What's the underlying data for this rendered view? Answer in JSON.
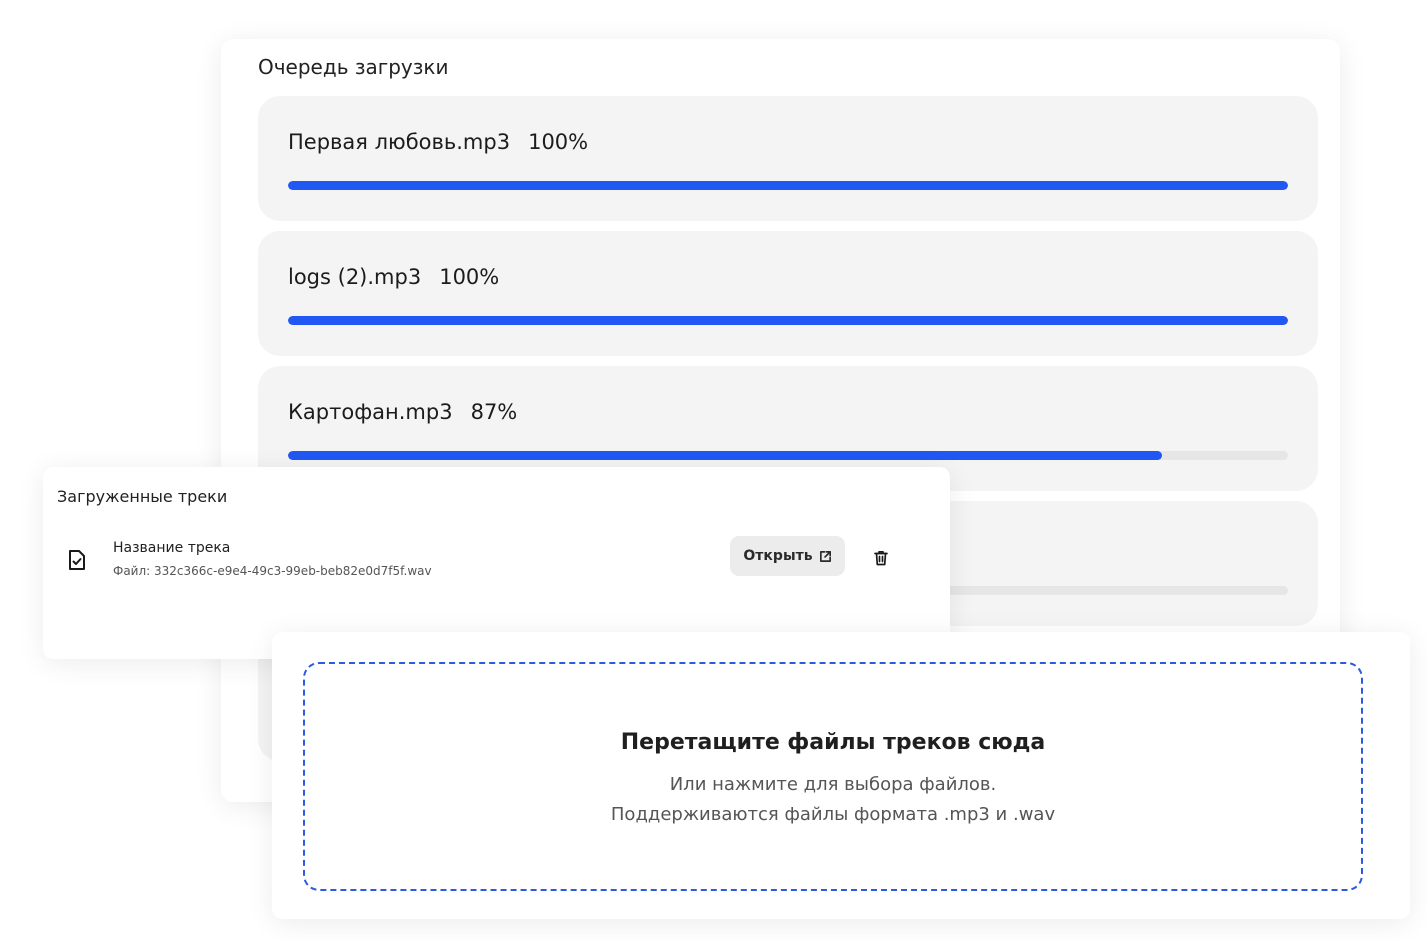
{
  "queue": {
    "title": "Очередь загрузки",
    "items": [
      {
        "name": "Первая любовь.mp3",
        "percent_label": "100%",
        "progress": 1.0
      },
      {
        "name": "logs (2).mp3",
        "percent_label": "100%",
        "progress": 1.0
      },
      {
        "name": "Картофан.mp3",
        "percent_label": "87%",
        "progress": 0.874
      },
      {
        "name": "",
        "percent_label": "",
        "progress": 0.0
      }
    ]
  },
  "uploaded": {
    "title": "Загруженные треки",
    "track": {
      "name": "Название трека",
      "file": "Файл: 332c366c-e9e4-49c3-99eb-beb82e0d7f5f.wav"
    },
    "open_label": "Открыть"
  },
  "dropzone": {
    "title": "Перетащите файлы треков сюда",
    "subtitle_1": "Или нажмите для выбора файлов.",
    "subtitle_2": "Поддерживаются файлы формата .mp3 и .wav"
  },
  "colors": {
    "accent": "#2157f3",
    "track_bg": "#e6e6e6",
    "item_bg": "#f4f4f4",
    "dash_border": "#2d5be0"
  }
}
